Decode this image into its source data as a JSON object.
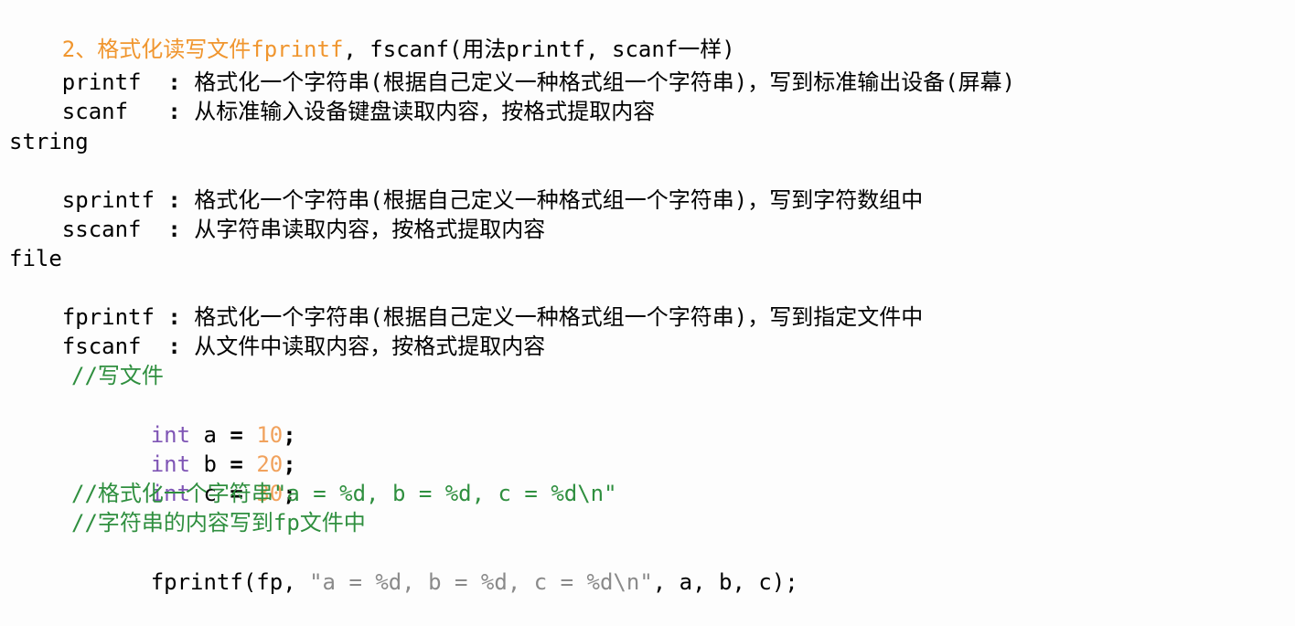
{
  "doc": {
    "title_prefix": "2、格式化读写文件fprintf",
    "title_suffix": ", fscanf(用法printf, scanf一样)",
    "stdio": [
      {
        "name": "printf  ",
        "sep": ":",
        "desc": " 格式化一个字符串(根据自己定义一种格式组一个字符串)，写到标准输出设备(屏幕)"
      },
      {
        "name": "scanf   ",
        "sep": ":",
        "desc": " 从标准输入设备键盘读取内容，按格式提取内容"
      }
    ],
    "string_heading": "string",
    "string_funcs": [
      {
        "name": "sprintf ",
        "sep": ":",
        "desc": " 格式化一个字符串(根据自己定义一种格式组一个字符串)，写到字符数组中"
      },
      {
        "name": "sscanf  ",
        "sep": ":",
        "desc": " 从字符串读取内容，按格式提取内容"
      }
    ],
    "file_heading": "file",
    "file_funcs": [
      {
        "name": "fprintf ",
        "sep": ":",
        "desc": " 格式化一个字符串(根据自己定义一种格式组一个字符串)，写到指定文件中"
      },
      {
        "name": "fscanf  ",
        "sep": ":",
        "desc": " 从文件中读取内容，按格式提取内容"
      }
    ]
  },
  "code": {
    "comment_write": "//写文件",
    "decls": [
      {
        "kw": "int",
        "var": " a ",
        "op": "=",
        "val": " 10",
        "end": ";"
      },
      {
        "kw": "int",
        "var": " b ",
        "op": "=",
        "val": " 20",
        "end": ";"
      },
      {
        "kw": "int",
        "var": " c ",
        "op": "=",
        "val": " 30",
        "end": ";"
      }
    ],
    "comment_format": "//格式化一个字符串\"a = %d, b = %d, c = %d\\n\"",
    "comment_dest": "//字符串的内容写到fp文件中",
    "call_fn": "fprintf(fp, ",
    "call_str": "\"a = %d, b = %d, c = %d\\n\"",
    "call_rest": ", a, b, c);"
  }
}
